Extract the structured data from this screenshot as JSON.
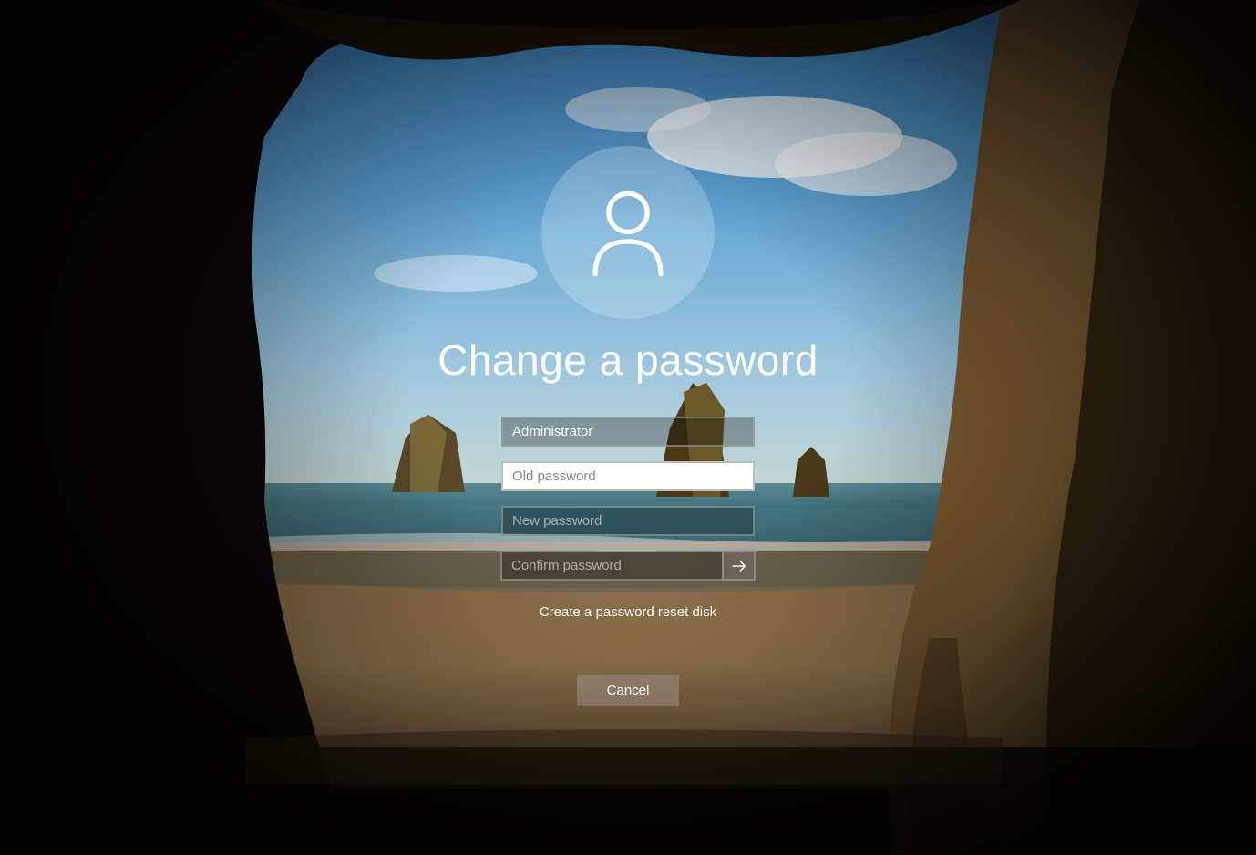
{
  "title": "Change a password",
  "fields": {
    "username": {
      "value": "Administrator"
    },
    "old_password": {
      "placeholder": "Old password",
      "value": ""
    },
    "new_password": {
      "placeholder": "New password",
      "value": ""
    },
    "confirm_password": {
      "placeholder": "Confirm password",
      "value": ""
    }
  },
  "links": {
    "reset_disk": "Create a password reset disk"
  },
  "buttons": {
    "cancel": "Cancel"
  }
}
